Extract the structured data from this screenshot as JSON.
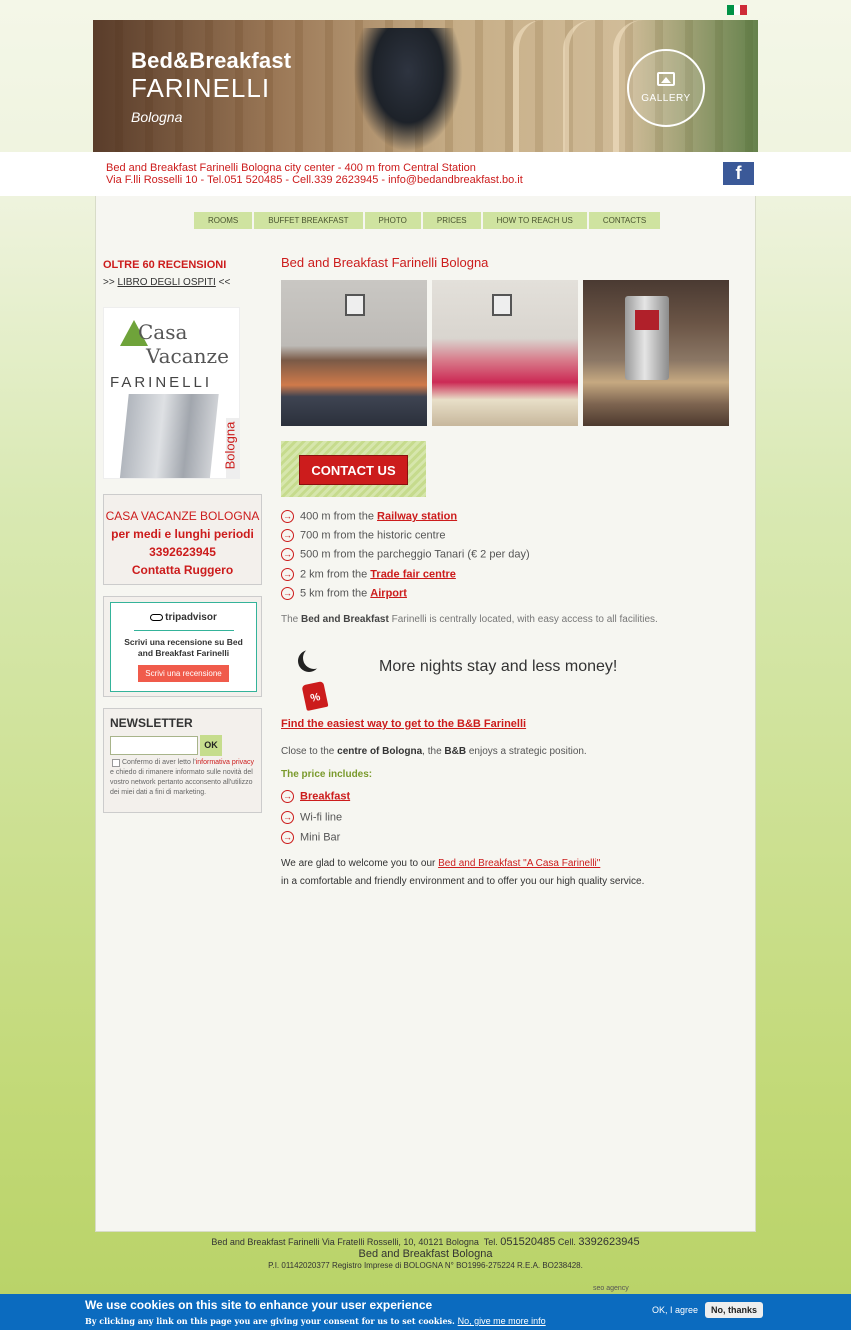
{
  "header": {
    "brand_line1": "Bed&Breakfast",
    "brand_line2": "FARINELLI",
    "brand_line3": "Bologna",
    "gallery_label": "GALLERY",
    "flag_colors": [
      "#009246",
      "#ffffff",
      "#ce2b37"
    ]
  },
  "infobar": {
    "line1": "Bed and Breakfast Farinelli Bologna city center - 400 m from Central Station",
    "line2": "Via F.lli Rosselli 10 - Tel.051 520485 - Cell.339 2623945 - info@bedandbreakfast.bo.it",
    "facebook_icon": "f"
  },
  "nav": {
    "items": [
      "ROOMS",
      "BUFFET BREAKFAST",
      "PHOTO",
      "PRICES",
      "HOW TO REACH US",
      "CONTACTS"
    ]
  },
  "sidebar": {
    "reviews_title": "OLTRE 60 RECENSIONI",
    "guestbook_prefix": ">>",
    "guestbook_link": "LIBRO DEGLI OSPITI",
    "guestbook_suffix": "<<",
    "logo_casa": "Casa",
    "logo_vacanze": "Vacanze",
    "logo_farinelli": "FARINELLI",
    "logo_bologna": "Bologna",
    "cv_title": "CASA VACANZE BOLOGNA",
    "cv_line2": "per medi e lunghi periodi",
    "cv_phone": "3392623945",
    "cv_contact": "Contatta Ruggero",
    "ta_logo": "tripadvisor",
    "ta_text": "Scrivi una recensione su Bed and Breakfast Farinelli",
    "ta_button": "Scrivi una recensione",
    "newsletter_title": "NEWSLETTER",
    "newsletter_ok": "OK",
    "newsletter_placeholder": "",
    "consent_pre": "Confermo di aver letto l'",
    "consent_link": "informativa privacy",
    "consent_post": " e chiedo di rimanere informato sulle novità del vostro network pertanto acconsento all'utilizzo dei miei dati a fini di marketing."
  },
  "main": {
    "title": "Bed and Breakfast Farinelli Bologna",
    "contact_button": "CONTACT US",
    "features": [
      {
        "pre": "400 m from the ",
        "link": "Railway station"
      },
      {
        "pre": "700 m from the historic centre",
        "link": ""
      },
      {
        "pre": "500 m from the parcheggio Tanari (€ 2 per day)",
        "link": ""
      },
      {
        "pre": "2 km from the ",
        "link": "Trade fair centre"
      },
      {
        "pre": "5 km from the ",
        "link": "Airport"
      }
    ],
    "intro_pre": "The ",
    "intro_bold": "Bed and Breakfast",
    "intro_post": " Farinelli is centrally located, with easy access to all facilities.",
    "promo_tag": "%",
    "promo": "More nights stay and less money!",
    "easy_link": "Find the easiest way to get to the B&B Farinelli",
    "strat_pre": "Close to the ",
    "strat_bold1": "centre of Bologna",
    "strat_mid": ", the ",
    "strat_bold2": "B&B",
    "strat_post": " enjoys a strategic position.",
    "includes_title": "The price includes:",
    "includes": [
      {
        "text": "Breakfast",
        "link": true
      },
      {
        "text": "Wi-fi line",
        "link": false
      },
      {
        "text": "Mini Bar",
        "link": false
      }
    ],
    "welcome_pre": "We are glad to welcome you to our ",
    "welcome_link": "Bed and Breakfast \"A Casa Farinelli\"",
    "welcome_line2": "in a comfortable and friendly environment and to offer you our high quality service."
  },
  "footer": {
    "address": "Bed and Breakfast Farinelli Via Fratelli Rosselli, 10, 40121 Bologna",
    "tel_label": "Tel.",
    "tel": "051520485",
    "cell_label": "Cell.",
    "cell": "3392623945",
    "name": "Bed and Breakfast Bologna",
    "legal": "P.I. 01142020377 Registro Imprese di BOLOGNA N° BO1996-275224 R.E.A. BO238428.",
    "seo": "seo agency"
  },
  "cookie": {
    "title": "We use cookies on this site to enhance your user experience",
    "text": "By clicking any link on this page you are giving your consent for us to set cookies.",
    "more_link": "No, give me more info",
    "agree": "OK, I agree",
    "decline": "No, thanks"
  }
}
